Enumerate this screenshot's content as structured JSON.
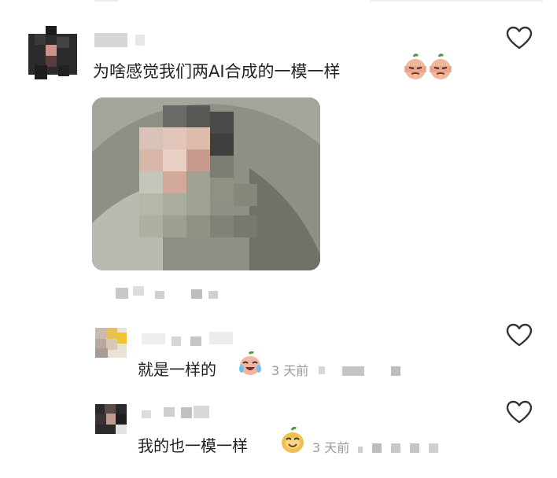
{
  "comments": [
    {
      "text": "为啥感觉我们两AI合成的一模一样",
      "emoji": [
        "pepper-face-emoji",
        "pepper-face-emoji"
      ],
      "liked": false
    }
  ],
  "replies": [
    {
      "text": "就是一样的",
      "time": "3 天前",
      "emoji": "laughing-crying-emoji",
      "liked": false
    },
    {
      "text": "我的也一模一样",
      "time": "3 天前",
      "emoji": "happy-bean-emoji",
      "liked": false
    }
  ],
  "colors": {
    "text": "#222222",
    "meta": "#9a9a9a",
    "heart": "#333333"
  }
}
